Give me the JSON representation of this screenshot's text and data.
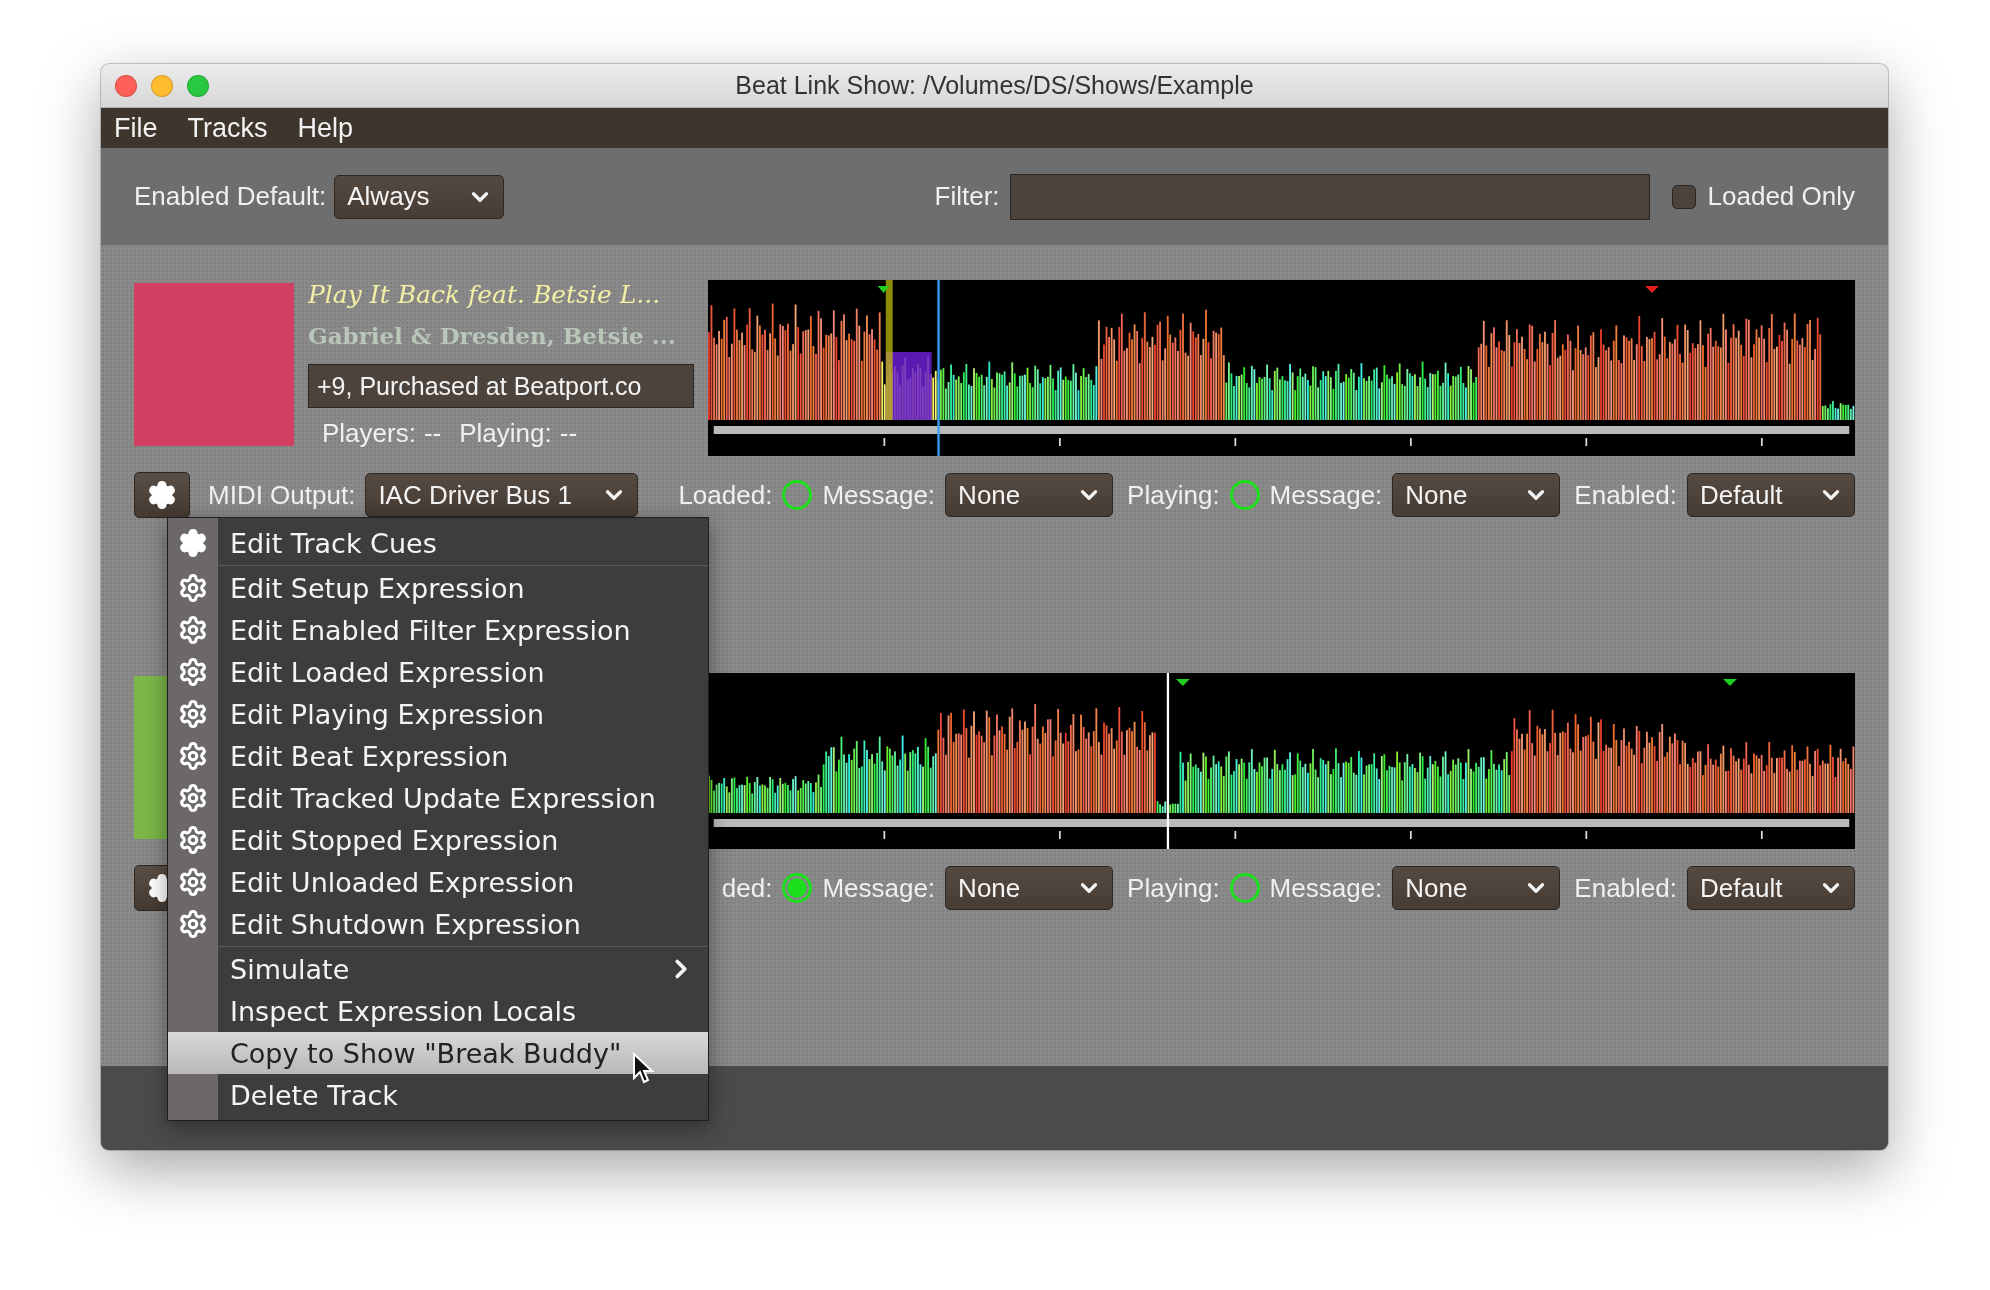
{
  "window": {
    "title": "Beat Link Show: /Volumes/DS/Shows/Example"
  },
  "menu_bar": [
    "File",
    "Tracks",
    "Help"
  ],
  "toolbar": {
    "enabled_default_label": "Enabled Default:",
    "enabled_default": "Always",
    "filter_label": "Filter:",
    "loaded_only": {
      "label": "Loaded Only",
      "checked": false
    }
  },
  "tracks": [
    {
      "title": "Play It Back feat. Betsie L...",
      "artist": "Gabriel & Dresden, Betsie ...",
      "comment": "+9, Purchased at Beatport.co",
      "players_label": "Players:",
      "players": "--",
      "playing_label": "Playing:",
      "playing": "--",
      "midi_label": "MIDI Output:",
      "midi_output": "IAC Driver Bus 1",
      "loaded_label": "Loaded:",
      "loaded": false,
      "loaded_message_label": "Message:",
      "loaded_message": "None",
      "playing_state_label": "Playing:",
      "playing_on": false,
      "playing_message_label": "Message:",
      "playing_message": "None",
      "enabled_label": "Enabled:",
      "enabled": "Default"
    },
    {
      "loaded_label": "ded:",
      "loaded": true,
      "loaded_message_label": "Message:",
      "loaded_message": "None",
      "playing_state_label": "Playing:",
      "playing_on": false,
      "playing_message_label": "Message:",
      "playing_message": "None",
      "enabled_label": "Enabled:",
      "enabled": "Default"
    }
  ],
  "context_menu": {
    "groups": [
      [
        {
          "label": "Edit Track Cues",
          "kind": "cue",
          "selected": false
        }
      ],
      [
        {
          "label": "Edit Setup Expression",
          "kind": "expression",
          "selected": false
        },
        {
          "label": "Edit Enabled Filter Expression",
          "kind": "expression",
          "selected": false
        },
        {
          "label": "Edit Loaded Expression",
          "kind": "expression",
          "selected": false
        },
        {
          "label": "Edit Playing Expression",
          "kind": "expression",
          "selected": false
        },
        {
          "label": "Edit Beat Expression",
          "kind": "expression",
          "selected": false
        },
        {
          "label": "Edit Tracked Update Expression",
          "kind": "expression",
          "selected": false
        },
        {
          "label": "Edit Stopped Expression",
          "kind": "expression",
          "selected": false
        },
        {
          "label": "Edit Unloaded Expression",
          "kind": "expression",
          "selected": false
        },
        {
          "label": "Edit Shutdown Expression",
          "kind": "expression",
          "selected": false
        }
      ],
      [
        {
          "label": "Simulate",
          "kind": "submenu",
          "selected": false
        },
        {
          "label": "Inspect Expression Locals",
          "kind": "plain",
          "selected": false
        },
        {
          "label": "Copy to Show \"Break Buddy\"",
          "kind": "plain",
          "selected": true
        },
        {
          "label": "Delete Track",
          "kind": "plain",
          "selected": false
        }
      ]
    ]
  }
}
